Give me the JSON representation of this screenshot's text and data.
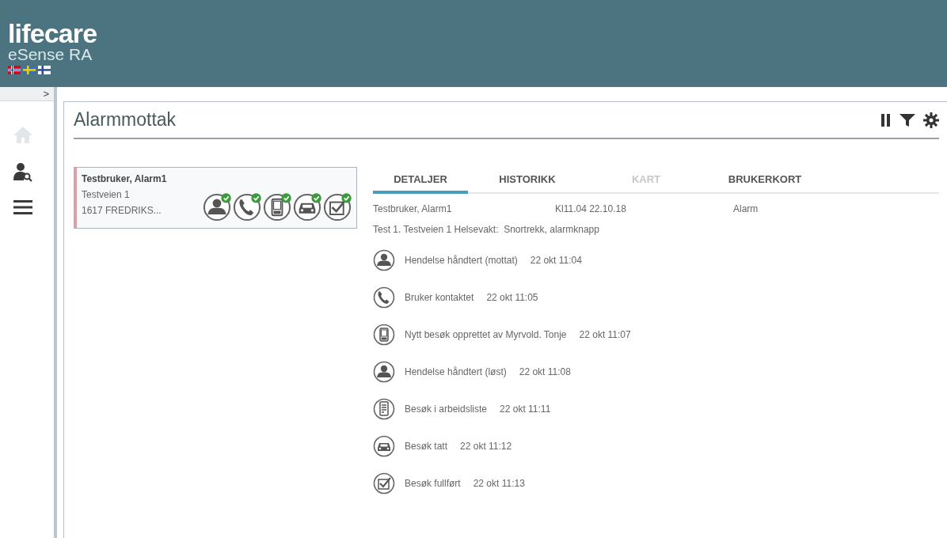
{
  "header": {
    "brand": "lifecare",
    "product": "eSense RA",
    "flags": [
      {
        "kind": "norway"
      },
      {
        "kind": "sweden"
      },
      {
        "kind": "finland"
      }
    ]
  },
  "sidebar": {
    "toggle": ">",
    "items": [
      {
        "kind": "home",
        "disabled": true
      },
      {
        "kind": "user-search",
        "disabled": false
      },
      {
        "kind": "menu",
        "disabled": false
      }
    ]
  },
  "page": {
    "title": "Alarmmottak",
    "tools": [
      {
        "kind": "pause"
      },
      {
        "kind": "filter"
      },
      {
        "kind": "settings"
      }
    ]
  },
  "alarm_card": {
    "name": "Testbruker, Alarm1",
    "address": "Testveien 1",
    "postal": "1617 FREDRIKS...",
    "color": "#d9a0a8",
    "steps": [
      {
        "kind": "person",
        "done": true
      },
      {
        "kind": "phone",
        "done": true
      },
      {
        "kind": "device",
        "done": true
      },
      {
        "kind": "car",
        "done": true
      },
      {
        "kind": "check",
        "done": true
      }
    ]
  },
  "tabs": [
    {
      "label": "DETALJER",
      "selected": true,
      "disabled": false
    },
    {
      "label": "HISTORIKK",
      "selected": false,
      "disabled": false
    },
    {
      "label": "KART",
      "selected": false,
      "disabled": true
    },
    {
      "label": "BRUKERKORT",
      "selected": false,
      "disabled": false
    }
  ],
  "details": {
    "user": "Testbruker, Alarm1",
    "time": "Kl11.04 22.10.18",
    "type": "Alarm",
    "info": "Test 1. Testveien 1 Helsevakt:  Snortrekk, alarmknapp"
  },
  "events": [
    {
      "kind": "person",
      "text": "Hendelse håndtert (mottat)",
      "time": "22 okt 11:04"
    },
    {
      "kind": "phone",
      "text": "Bruker kontaktet",
      "time": "22 okt 11:05"
    },
    {
      "kind": "device",
      "text": "Nytt besøk opprettet av Myrvold. Tonje",
      "time": "22 okt 11:07"
    },
    {
      "kind": "person",
      "text": "Hendelse håndtert (løst)",
      "time": "22 okt 11:08"
    },
    {
      "kind": "list",
      "text": "Besøk i arbeidsliste",
      "time": "22 okt 11:11"
    },
    {
      "kind": "car",
      "text": "Besøk tatt",
      "time": "22 okt 11:12"
    },
    {
      "kind": "check",
      "text": "Besøk fullført",
      "time": "22 okt 11:13"
    }
  ]
}
